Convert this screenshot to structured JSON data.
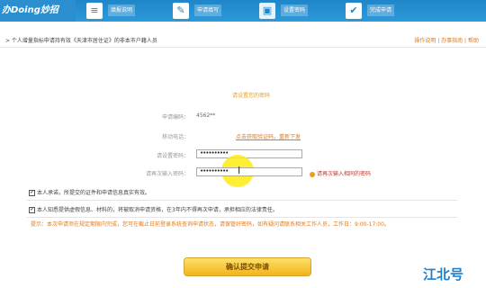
{
  "logo": "办Doing妙招",
  "steps": [
    {
      "label": "填报说明",
      "icon": "document-icon"
    },
    {
      "label": "申请填写",
      "icon": "pencil-icon"
    },
    {
      "label": "设置密码",
      "icon": "lock-icon"
    },
    {
      "label": "完成申请",
      "icon": "check-icon"
    }
  ],
  "header": {
    "title": "> 个人增量指标申请持有效《天津市居住证》的非本市户籍人员",
    "links": "操作说明 | 办事指南 | 帮助"
  },
  "form": {
    "message": "请设置您的密码",
    "applicant_label": "申请编码：",
    "applicant_value": "4562**",
    "mobile_label": "移动电话：",
    "mobile_link": "点击获取验证码，重新下发",
    "password_label": "请设置密码：",
    "password_value": "••••••••••",
    "confirm_label": "请再次输入密码：",
    "confirm_value": "••••••••••",
    "confirm_hint": "请再次输入相同的密码"
  },
  "checks": [
    "本人承诺，所提交的证件和申请信息真实有效。",
    "本人知悉提供虚假信息、材料的，将被取消申请资格，在3年内不得再次申请，承担相应的法律责任。"
  ],
  "warning": "提示：本次申请须在规定期限内完成，您可在截止日前登录系统查询申请状态，请保管好密码，如有疑问请联系相关工作人员，工作日：9:00-17:00。",
  "submit_label": "确认提交申请",
  "watermark": "江北号"
}
